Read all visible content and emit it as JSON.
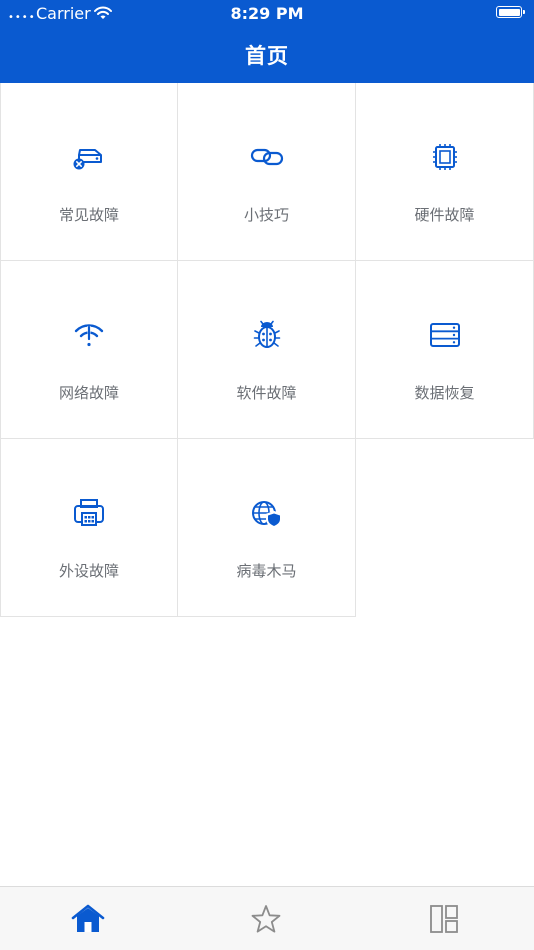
{
  "status_bar": {
    "carrier": "Carrier",
    "time": "8:29 PM"
  },
  "header": {
    "title": "首页"
  },
  "grid": {
    "items": [
      {
        "label": "常见故障",
        "icon": "hard-drive-error-icon"
      },
      {
        "label": "小技巧",
        "icon": "link-icon"
      },
      {
        "label": "硬件故障",
        "icon": "chip-icon"
      },
      {
        "label": "网络故障",
        "icon": "wifi-off-icon"
      },
      {
        "label": "软件故障",
        "icon": "bug-icon"
      },
      {
        "label": "数据恢复",
        "icon": "server-icon"
      },
      {
        "label": "外设故障",
        "icon": "printer-icon"
      },
      {
        "label": "病毒木马",
        "icon": "globe-shield-icon"
      }
    ]
  },
  "tab_bar": {
    "items": [
      {
        "icon": "home-icon",
        "active": true
      },
      {
        "icon": "star-icon",
        "active": false
      },
      {
        "icon": "layout-icon",
        "active": false
      }
    ]
  },
  "colors": {
    "accent": "#0a5ad0",
    "label": "#6b6f75",
    "inactive_tab": "#8c8c8c"
  }
}
